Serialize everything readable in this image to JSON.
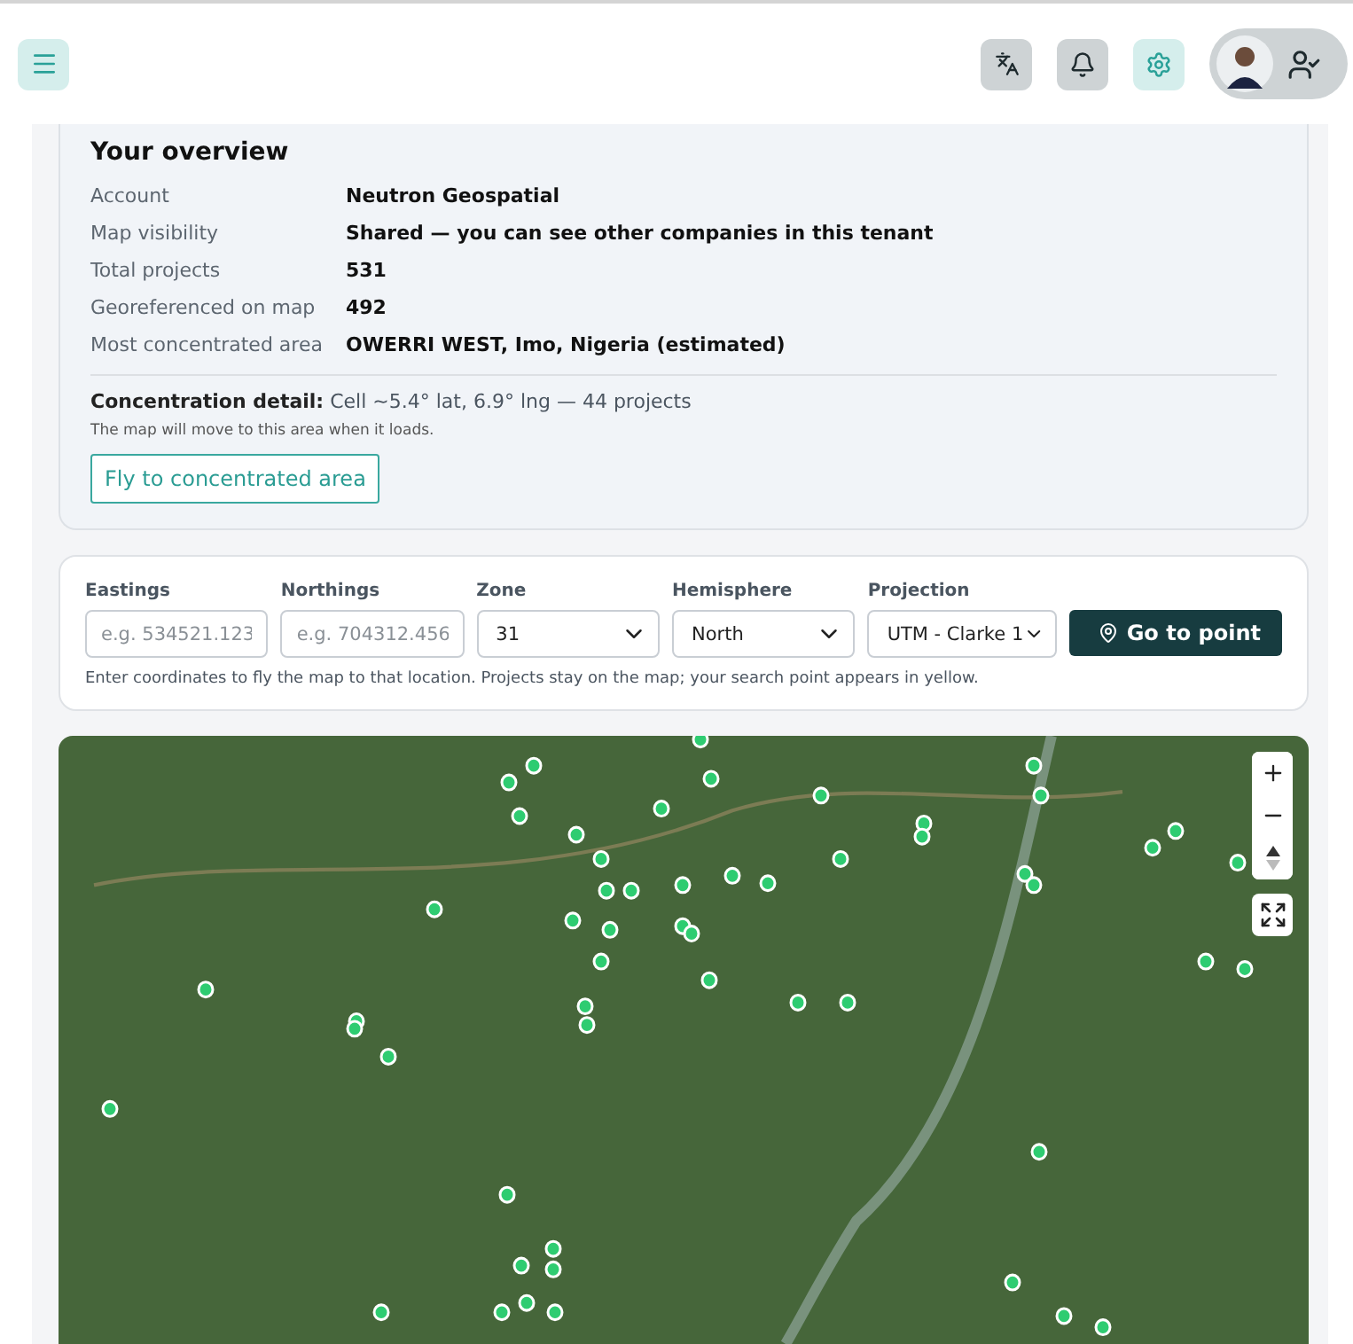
{
  "overview": {
    "title": "Your overview",
    "rows": [
      {
        "label": "Account",
        "value": "Neutron Geospatial"
      },
      {
        "label": "Map visibility",
        "value": "Shared — you can see other companies in this tenant"
      },
      {
        "label": "Total projects",
        "value": "531"
      },
      {
        "label": "Georeferenced on map",
        "value": "492"
      },
      {
        "label": "Most concentrated area",
        "value": "OWERRI WEST, Imo, Nigeria (estimated)"
      }
    ],
    "detail": "**Concentration detail:** Cell ~5.4° lat, 6.9° lng — 44 projects",
    "note": "The map will move to this area when it loads.",
    "button": "Fly to concentrated area"
  },
  "search": {
    "fields": [
      {
        "kind": "input",
        "label": "Eastings",
        "placeholder": "e.g. 534521.123"
      },
      {
        "kind": "input",
        "label": "Northings",
        "placeholder": "e.g. 704312.456"
      },
      {
        "kind": "select",
        "label": "Zone",
        "value": "31"
      },
      {
        "kind": "select",
        "label": "Hemisphere",
        "value": "North"
      },
      {
        "kind": "select",
        "label": "Projection",
        "value": "UTM - Clarke 1"
      }
    ],
    "button": "Go to point",
    "hint": "Enter coordinates to fly the map to that location. Projects stay on the map; your search point appears in yellow."
  }
}
